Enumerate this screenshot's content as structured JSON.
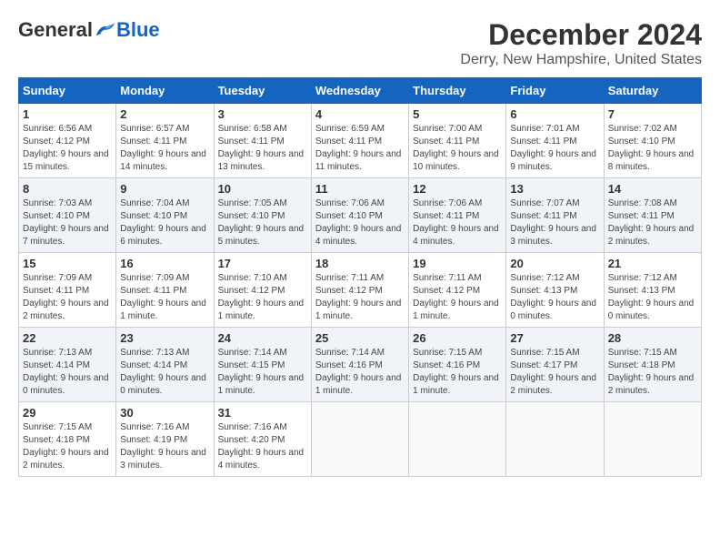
{
  "header": {
    "logo_general": "General",
    "logo_blue": "Blue",
    "title": "December 2024",
    "subtitle": "Derry, New Hampshire, United States"
  },
  "days_of_week": [
    "Sunday",
    "Monday",
    "Tuesday",
    "Wednesday",
    "Thursday",
    "Friday",
    "Saturday"
  ],
  "weeks": [
    [
      {
        "day": "1",
        "sunrise": "6:56 AM",
        "sunset": "4:12 PM",
        "daylight": "9 hours and 15 minutes."
      },
      {
        "day": "2",
        "sunrise": "6:57 AM",
        "sunset": "4:11 PM",
        "daylight": "9 hours and 14 minutes."
      },
      {
        "day": "3",
        "sunrise": "6:58 AM",
        "sunset": "4:11 PM",
        "daylight": "9 hours and 13 minutes."
      },
      {
        "day": "4",
        "sunrise": "6:59 AM",
        "sunset": "4:11 PM",
        "daylight": "9 hours and 11 minutes."
      },
      {
        "day": "5",
        "sunrise": "7:00 AM",
        "sunset": "4:11 PM",
        "daylight": "9 hours and 10 minutes."
      },
      {
        "day": "6",
        "sunrise": "7:01 AM",
        "sunset": "4:11 PM",
        "daylight": "9 hours and 9 minutes."
      },
      {
        "day": "7",
        "sunrise": "7:02 AM",
        "sunset": "4:10 PM",
        "daylight": "9 hours and 8 minutes."
      }
    ],
    [
      {
        "day": "8",
        "sunrise": "7:03 AM",
        "sunset": "4:10 PM",
        "daylight": "9 hours and 7 minutes."
      },
      {
        "day": "9",
        "sunrise": "7:04 AM",
        "sunset": "4:10 PM",
        "daylight": "9 hours and 6 minutes."
      },
      {
        "day": "10",
        "sunrise": "7:05 AM",
        "sunset": "4:10 PM",
        "daylight": "9 hours and 5 minutes."
      },
      {
        "day": "11",
        "sunrise": "7:06 AM",
        "sunset": "4:10 PM",
        "daylight": "9 hours and 4 minutes."
      },
      {
        "day": "12",
        "sunrise": "7:06 AM",
        "sunset": "4:11 PM",
        "daylight": "9 hours and 4 minutes."
      },
      {
        "day": "13",
        "sunrise": "7:07 AM",
        "sunset": "4:11 PM",
        "daylight": "9 hours and 3 minutes."
      },
      {
        "day": "14",
        "sunrise": "7:08 AM",
        "sunset": "4:11 PM",
        "daylight": "9 hours and 2 minutes."
      }
    ],
    [
      {
        "day": "15",
        "sunrise": "7:09 AM",
        "sunset": "4:11 PM",
        "daylight": "9 hours and 2 minutes."
      },
      {
        "day": "16",
        "sunrise": "7:09 AM",
        "sunset": "4:11 PM",
        "daylight": "9 hours and 1 minute."
      },
      {
        "day": "17",
        "sunrise": "7:10 AM",
        "sunset": "4:12 PM",
        "daylight": "9 hours and 1 minute."
      },
      {
        "day": "18",
        "sunrise": "7:11 AM",
        "sunset": "4:12 PM",
        "daylight": "9 hours and 1 minute."
      },
      {
        "day": "19",
        "sunrise": "7:11 AM",
        "sunset": "4:12 PM",
        "daylight": "9 hours and 1 minute."
      },
      {
        "day": "20",
        "sunrise": "7:12 AM",
        "sunset": "4:13 PM",
        "daylight": "9 hours and 0 minutes."
      },
      {
        "day": "21",
        "sunrise": "7:12 AM",
        "sunset": "4:13 PM",
        "daylight": "9 hours and 0 minutes."
      }
    ],
    [
      {
        "day": "22",
        "sunrise": "7:13 AM",
        "sunset": "4:14 PM",
        "daylight": "9 hours and 0 minutes."
      },
      {
        "day": "23",
        "sunrise": "7:13 AM",
        "sunset": "4:14 PM",
        "daylight": "9 hours and 0 minutes."
      },
      {
        "day": "24",
        "sunrise": "7:14 AM",
        "sunset": "4:15 PM",
        "daylight": "9 hours and 1 minute."
      },
      {
        "day": "25",
        "sunrise": "7:14 AM",
        "sunset": "4:16 PM",
        "daylight": "9 hours and 1 minute."
      },
      {
        "day": "26",
        "sunrise": "7:15 AM",
        "sunset": "4:16 PM",
        "daylight": "9 hours and 1 minute."
      },
      {
        "day": "27",
        "sunrise": "7:15 AM",
        "sunset": "4:17 PM",
        "daylight": "9 hours and 2 minutes."
      },
      {
        "day": "28",
        "sunrise": "7:15 AM",
        "sunset": "4:18 PM",
        "daylight": "9 hours and 2 minutes."
      }
    ],
    [
      {
        "day": "29",
        "sunrise": "7:15 AM",
        "sunset": "4:18 PM",
        "daylight": "9 hours and 2 minutes."
      },
      {
        "day": "30",
        "sunrise": "7:16 AM",
        "sunset": "4:19 PM",
        "daylight": "9 hours and 3 minutes."
      },
      {
        "day": "31",
        "sunrise": "7:16 AM",
        "sunset": "4:20 PM",
        "daylight": "9 hours and 4 minutes."
      },
      null,
      null,
      null,
      null
    ]
  ]
}
